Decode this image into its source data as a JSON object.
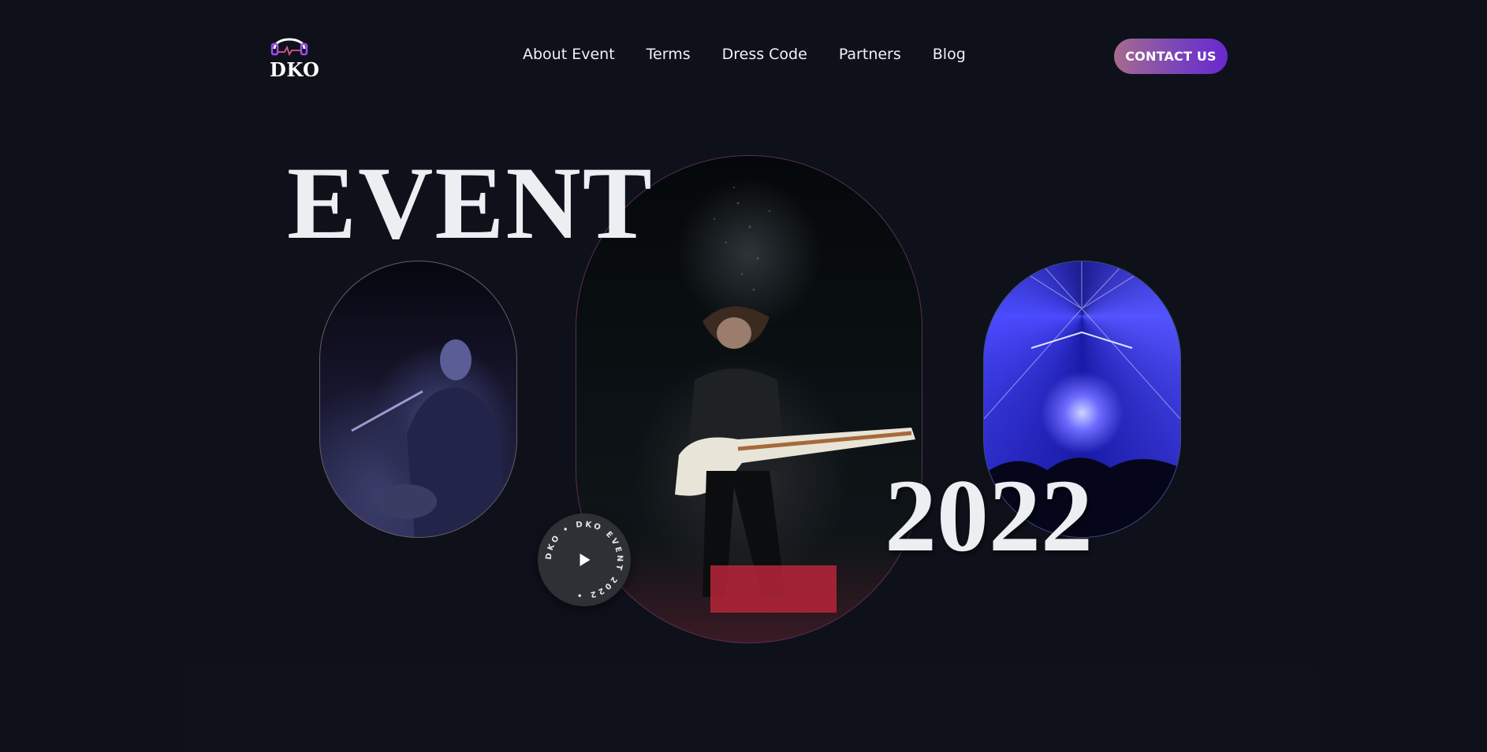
{
  "brand": {
    "logo_text": "DKO",
    "logo_icon": "headphones-pulse-icon",
    "accent_gradient": [
      "#a86a8e",
      "#6a27d0"
    ]
  },
  "nav": {
    "items": [
      {
        "label": "About Event"
      },
      {
        "label": "Terms"
      },
      {
        "label": "Dress Code"
      },
      {
        "label": "Partners"
      },
      {
        "label": "Blog"
      }
    ]
  },
  "header": {
    "contact_label": "CONTACT US"
  },
  "hero": {
    "title": "EVENT",
    "year": "2022",
    "play_badge": {
      "circular_text": "DKO • DKO EVENT 2022 •",
      "icon": "play-icon"
    },
    "images": {
      "left": "singer-with-guitar-photo",
      "center": "bass-guitarist-headbang-photo",
      "right": "laser-stage-concert-photo"
    }
  },
  "colors": {
    "background": "#0e111a",
    "text": "#eceef2"
  }
}
